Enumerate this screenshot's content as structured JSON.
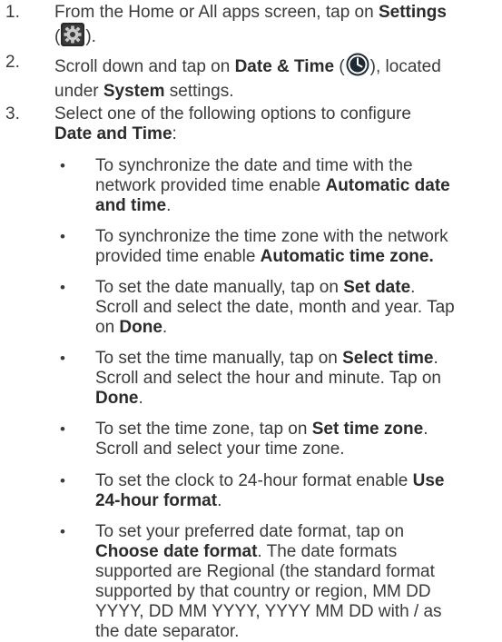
{
  "steps": [
    {
      "number": "1.",
      "lines": [
        {
          "pre": "From the Home or All apps screen, tap on ",
          "bold": "Settings",
          "post": ""
        },
        {
          "pre": "(",
          "icon": "settings-gear-icon",
          "post": ")."
        }
      ]
    },
    {
      "number": "2.",
      "lines": [
        {
          "pre": "Scroll down and tap on ",
          "bold": "Date & Time",
          "pre2": " (",
          "icon": "clock-icon",
          "post": "), located"
        },
        {
          "pre": "under ",
          "bold": "System",
          "post": " settings."
        }
      ]
    },
    {
      "number": "3.",
      "lines": [
        {
          "pre": "Select one of the following options to configure"
        },
        {
          "bold": "Date and Time",
          "post": ":"
        }
      ]
    }
  ],
  "bullets": [
    {
      "lines": [
        {
          "pre": "To synchronize the date and time with the"
        },
        {
          "pre": "network provided time enable ",
          "bold": "Automatic date"
        },
        {
          "bold": "and time",
          "post": "."
        }
      ]
    },
    {
      "lines": [
        {
          "pre": "To synchronize the time zone with the network"
        },
        {
          "pre": "provided time enable ",
          "bold": "Automatic time zone."
        }
      ]
    },
    {
      "lines": [
        {
          "pre": "To set the date manually, tap on ",
          "bold": "Set date",
          "post": "."
        },
        {
          "pre": "Scroll and select the date, month and year. Tap"
        },
        {
          "pre": "on ",
          "bold": "Done",
          "post": "."
        }
      ]
    },
    {
      "lines": [
        {
          "pre": "To set the time manually, tap on ",
          "bold": "Select time",
          "post": "."
        },
        {
          "pre": "Scroll and select the hour and minute. Tap on"
        },
        {
          "bold": "Done",
          "post": "."
        }
      ]
    },
    {
      "lines": [
        {
          "pre": "To set the time zone, tap on ",
          "bold": "Set time zone",
          "post": "."
        },
        {
          "pre": "Scroll and select your time zone."
        }
      ]
    },
    {
      "lines": [
        {
          "pre": "To set the clock to 24-hour format enable ",
          "bold": "Use"
        },
        {
          "bold": "24-hour format",
          "post": "."
        }
      ]
    },
    {
      "lines": [
        {
          "pre": "To set your preferred date format, tap on"
        },
        {
          "bold": "Choose date format",
          "post": ". The date formats"
        },
        {
          "pre": "supported are Regional (the standard format"
        },
        {
          "pre": "supported by that country or region, MM DD"
        },
        {
          "pre": "YYYY, DD MM YYYY, YYYY MM DD with / as"
        },
        {
          "pre": "the date separator."
        }
      ]
    }
  ],
  "bullet_char": "•"
}
